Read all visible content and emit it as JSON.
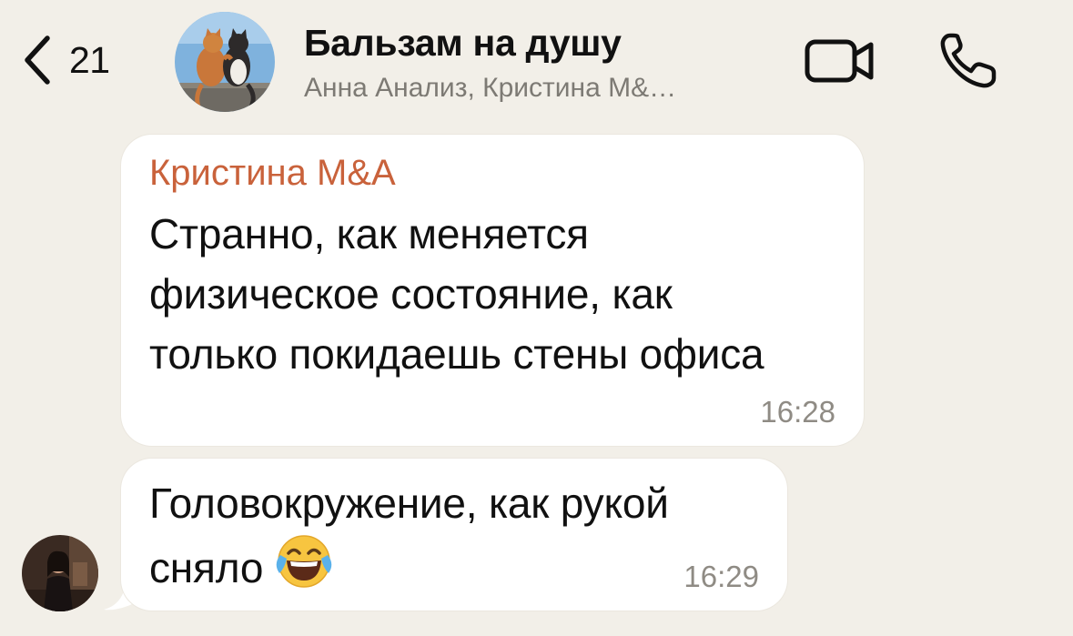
{
  "header": {
    "back_count": "21",
    "title": "Бальзам на душу",
    "subtitle": "Анна Анализ, Кристина М&…"
  },
  "messages": [
    {
      "sender": "Кристина M&A",
      "lines": [
        "Странно, как меняется",
        "физическое состояние, как",
        "только покидаешь стены офиса"
      ],
      "time": "16:28"
    },
    {
      "lines": [
        "Головокружение, как рукой",
        "сняло"
      ],
      "time": "16:29",
      "emoji": "face-with-tears-of-joy"
    }
  ],
  "icons": {
    "back": "chevron-left-icon",
    "video": "video-camera-icon",
    "call": "phone-icon"
  },
  "colors": {
    "background": "#f2efe8",
    "bubble": "#ffffff",
    "sender_name": "#c9623b",
    "timestamp": "#8f8b84",
    "subtitle": "#7d7a74"
  }
}
